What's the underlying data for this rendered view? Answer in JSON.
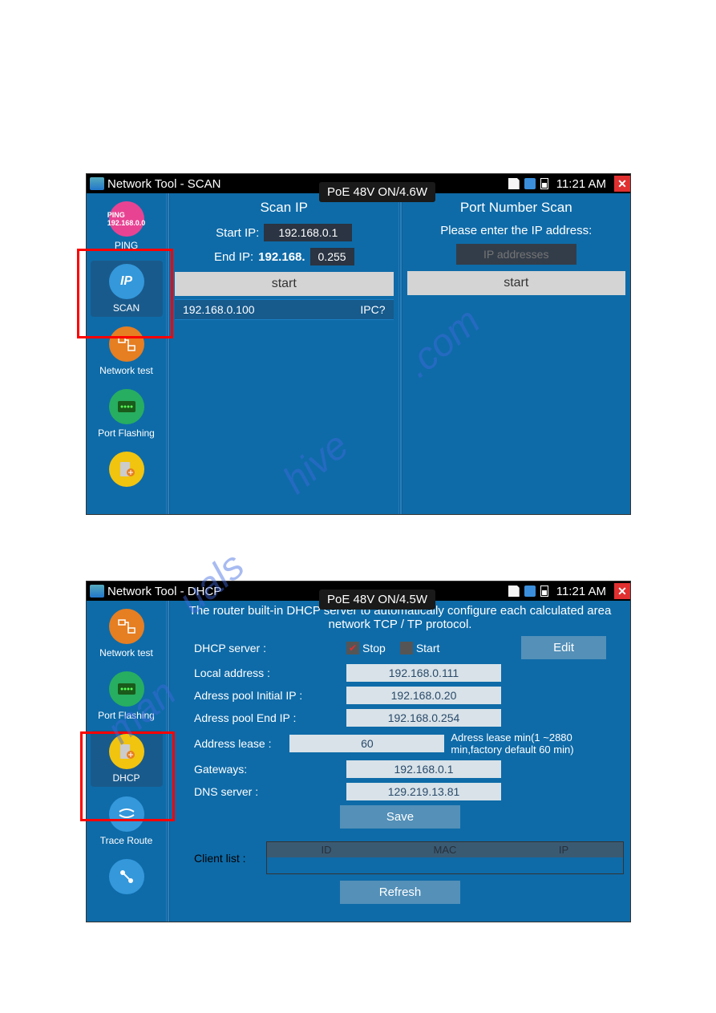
{
  "screen1": {
    "title": "Network Tool - SCAN",
    "poe": "PoE 48V ON/4.6W",
    "time": "11:21 AM",
    "sidebar": [
      {
        "label": "PING",
        "sub": ""
      },
      {
        "label": "SCAN",
        "icon_text": "IP"
      },
      {
        "label": "Network test"
      },
      {
        "label": "Port Flashing"
      },
      {
        "label": ""
      }
    ],
    "scan_ip": {
      "title": "Scan IP",
      "start_label": "Start IP:",
      "start_val": "192.168.0.1",
      "end_label": "End IP:",
      "end_prefix": "192.168.",
      "end_suffix": "0.255",
      "button": "start",
      "result_ip": "192.168.0.100",
      "result_type": "IPC?"
    },
    "port_scan": {
      "title": "Port Number Scan",
      "prompt": "Please enter the IP address:",
      "placeholder": "IP addresses",
      "button": "start"
    }
  },
  "screen2": {
    "title": "Network Tool - DHCP",
    "poe": "PoE 48V ON/4.5W",
    "time": "11:21 AM",
    "sidebar": [
      {
        "label": "Network test"
      },
      {
        "label": "Port Flashing"
      },
      {
        "label": "DHCP"
      },
      {
        "label": "Trace Route"
      },
      {
        "label": ""
      }
    ],
    "dhcp": {
      "desc": "The router built-in DHCP server to automatically configure each calculated area network TCP / TP protocol.",
      "server_label": "DHCP server :",
      "stop_label": "Stop",
      "start_label": "Start",
      "edit_btn": "Edit",
      "local_label": "Local address :",
      "local_val": "192.168.0.111",
      "pool_init_label": "Adress pool Initial IP :",
      "pool_init_val": "192.168.0.20",
      "pool_end_label": "Adress pool End IP :",
      "pool_end_val": "192.168.0.254",
      "lease_label": "Address lease :",
      "lease_val": "60",
      "lease_hint": "Adress lease min(1 ~2880 min,factory default 60 min)",
      "gateway_label": "Gateways:",
      "gateway_val": "192.168.0.1",
      "dns_label": "DNS server :",
      "dns_val": "129.219.13.81",
      "save_btn": "Save",
      "client_label": "Client list :",
      "col_id": "ID",
      "col_mac": "MAC",
      "col_ip": "IP",
      "refresh_btn": "Refresh"
    }
  }
}
